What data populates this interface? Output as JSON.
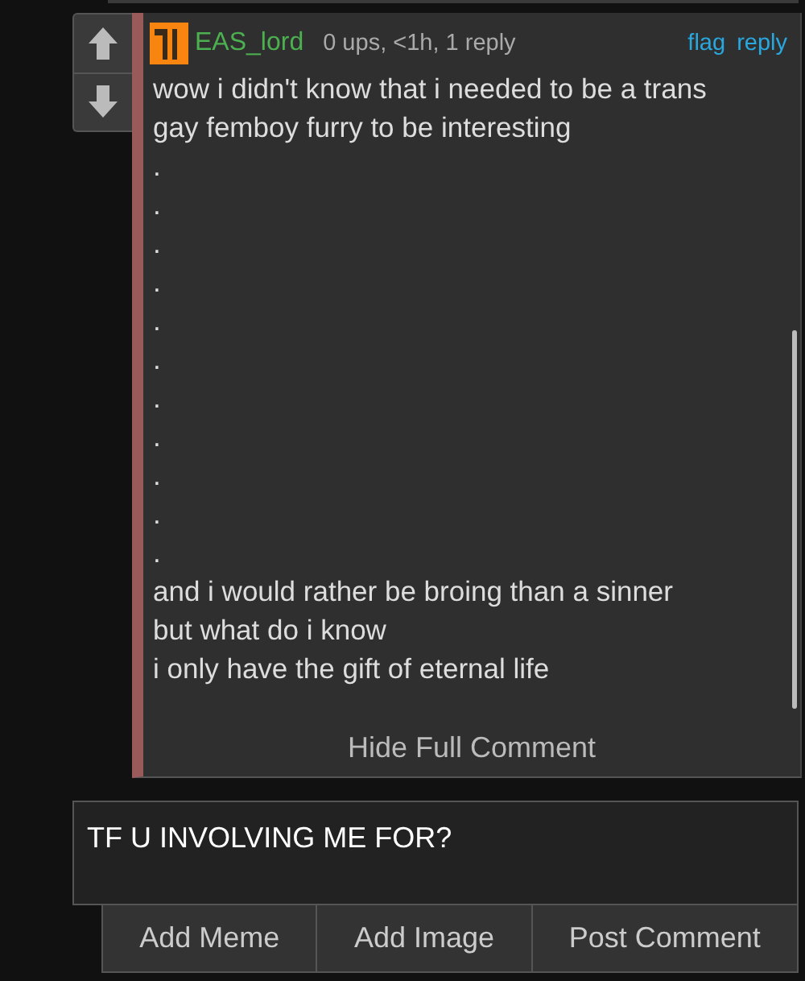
{
  "comment": {
    "author": "EAS_lord",
    "meta": "0 ups, <1h, 1 reply",
    "actions": [
      "flag",
      "reply"
    ],
    "lines": [
      "wow i didn't know that i needed to be a trans",
      "gay femboy furry to be interesting",
      ".",
      ".",
      ".",
      ".",
      ".",
      ".",
      ".",
      ".",
      ".",
      ".",
      ".",
      "and i would rather be broing than a sinner",
      "but what do i know",
      "i only have the gift of eternal life"
    ],
    "toggle": "Hide Full Comment"
  },
  "reply_box": {
    "value": "TF U INVOLVING ME FOR?"
  },
  "buttons": [
    "Add Meme",
    "Add Image",
    "Post Comment"
  ]
}
